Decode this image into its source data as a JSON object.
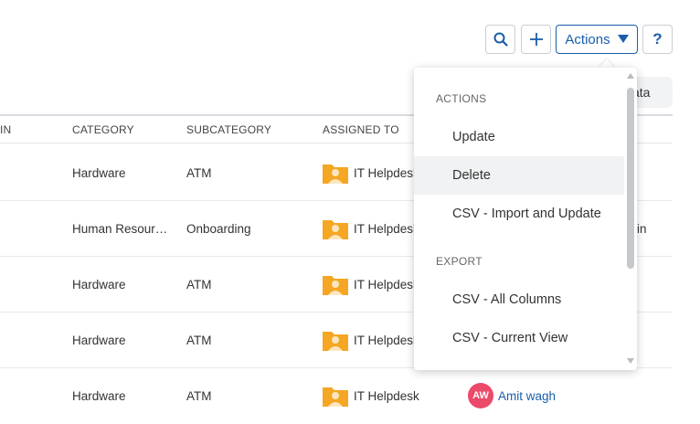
{
  "toolbar": {
    "actions_label": "Actions",
    "help_label": "?"
  },
  "chip": {
    "label": "ata"
  },
  "table": {
    "headers": [
      "IN",
      "CATEGORY",
      "SUBCATEGORY",
      "ASSIGNED TO"
    ],
    "rows": [
      {
        "category": "Hardware",
        "subcategory": "ATM",
        "assigned": "IT Helpdesk"
      },
      {
        "category": "Human Resour…",
        "subcategory": "Onboarding",
        "assigned": "IT Helpdesk",
        "extra": "in"
      },
      {
        "category": "Hardware",
        "subcategory": "ATM",
        "assigned": "IT Helpdesk"
      },
      {
        "category": "Hardware",
        "subcategory": "ATM",
        "assigned": "IT Helpdesk"
      },
      {
        "category": "Hardware",
        "subcategory": "ATM",
        "assigned": "IT Helpdesk",
        "avatar": "AW",
        "owner": "Amit wagh"
      }
    ]
  },
  "dropdown": {
    "section_actions": "ACTIONS",
    "actions": [
      "Update",
      "Delete",
      "CSV - Import and Update"
    ],
    "section_export": "EXPORT",
    "export": [
      "CSV - All Columns",
      "CSV - Current View"
    ],
    "hovered_item": "Delete"
  },
  "colors": {
    "accent": "#1a5dab",
    "folder": "#f5a623",
    "avatar": "#ec4a6a"
  }
}
